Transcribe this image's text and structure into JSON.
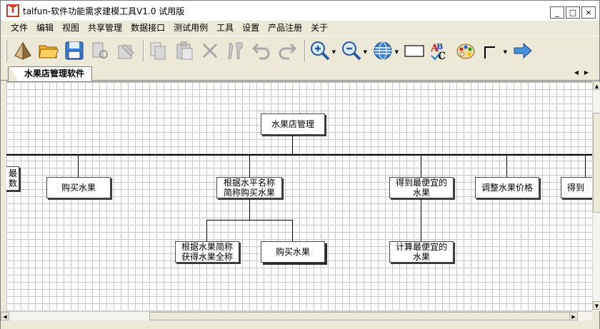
{
  "window": {
    "title": "talfun-软件功能需求建模工具V1.0 试用版",
    "icon_glyph": "T"
  },
  "window_buttons": {
    "minimize": "_",
    "maximize": "□",
    "close": "×"
  },
  "menu": [
    "文件",
    "编辑",
    "视图",
    "共享管理",
    "数据接口",
    "测试用例",
    "工具",
    "设置",
    "产品注册",
    "关于"
  ],
  "toolbar": {
    "icons": [
      "new-document-icon",
      "open-folder-icon",
      "save-icon",
      "cut-disabled-icon",
      "paste-special-disabled-icon",
      "copy-disabled-icon",
      "paste-disabled-icon",
      "delete-disabled-icon",
      "properties-disabled-icon",
      "undo-disabled-icon",
      "redo-disabled-icon",
      "zoom-in-icon",
      "zoom-out-icon",
      "globe-icon",
      "rectangle-icon",
      "spell-check-icon",
      "color-palette-icon",
      "connector-icon",
      "forward-arrow-icon"
    ]
  },
  "tabs": [
    {
      "label": "水果店管理软件"
    }
  ],
  "diagram": {
    "root": "水果店管理",
    "level1": [
      {
        "label": "最\n数"
      },
      {
        "label": "购买水果"
      },
      {
        "label": "根据水平名称\n简称购买水果"
      },
      {
        "label": "得到最便宜的\n水果"
      },
      {
        "label": "调整水果价格"
      },
      {
        "label": "得到"
      }
    ],
    "level2": [
      {
        "label": "根据水果简称\n获得水果全称"
      },
      {
        "label": "购买水果"
      },
      {
        "label": "计算最便宜的\n水果"
      }
    ]
  },
  "colors": {
    "title_icon": "#d83820",
    "accent_arrow": "#4a90d9"
  }
}
